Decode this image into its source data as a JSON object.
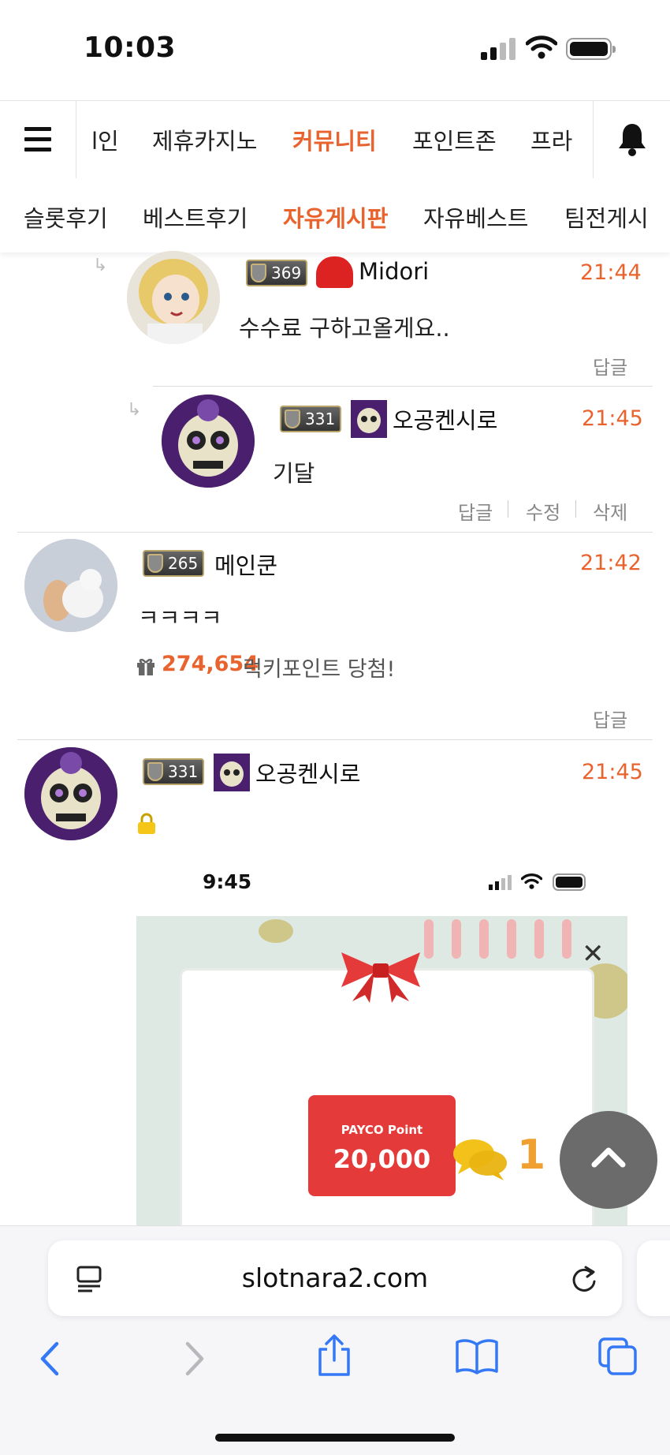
{
  "status_bar": {
    "time": "10:03"
  },
  "main_nav": {
    "items": [
      "l인",
      "제휴카지노",
      "커뮤니티",
      "포인트존",
      "프라"
    ],
    "active": "커뮤니티"
  },
  "sub_nav": {
    "items": [
      "슬롯후기",
      "베스트후기",
      "자유게시판",
      "자유베스트",
      "팀전게시"
    ],
    "active": "자유게시판"
  },
  "comments": [
    {
      "level": "369",
      "nick": "Midori",
      "time": "21:44",
      "text": "수수료 구하고올게요..",
      "actions": [
        "답글"
      ]
    },
    {
      "level": "331",
      "nick": "오공켄시로",
      "time": "21:45",
      "text": "기달",
      "actions": [
        "답글",
        "수정",
        "삭제"
      ]
    },
    {
      "level": "265",
      "nick": "메인쿤",
      "time": "21:42",
      "text": "ㅋㅋㅋㅋ",
      "lucky_amount": "274,654",
      "lucky_text": "럭키포인트 당첨!",
      "actions": [
        "답글"
      ]
    },
    {
      "level": "331",
      "nick": "오공켄시로",
      "time": "21:45"
    }
  ],
  "embedded": {
    "time": "9:45",
    "payco_brand": "PAYCO Point",
    "payco_amount": "20,000"
  },
  "comment_count": "1",
  "safari": {
    "url": "slotnara2.com"
  },
  "colors": {
    "accent": "#e8632d",
    "ios_blue": "#3478f6"
  }
}
